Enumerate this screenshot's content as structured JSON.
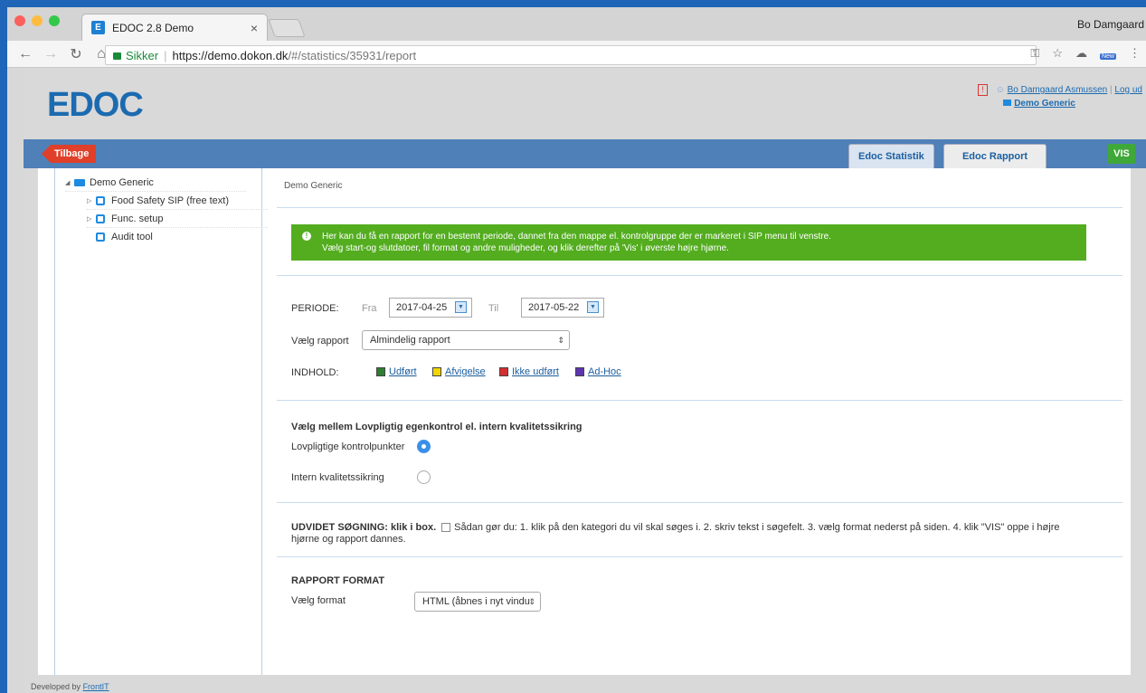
{
  "browser": {
    "tab_title": "EDOC 2.8 Demo",
    "tab_favicon": "E",
    "tab_close": "×",
    "user": "Bo Damgaard",
    "secure_label": "Sikker",
    "url_host": "https://demo.dokon.dk",
    "url_path": "/#/statistics/35931/report",
    "new_badge": "New",
    "colors": {
      "close": "#fc605c",
      "minimize": "#fdbc40",
      "maximize": "#34c84a"
    }
  },
  "header": {
    "logo": "EDOC",
    "alert": "!",
    "user_link": "Bo Damgaard Asmussen",
    "logout": "Log ud",
    "org": "Demo Generic"
  },
  "nav": {
    "back": "Tilbage",
    "tab_statistik": "Edoc Statistik",
    "tab_rapport": "Edoc Rapport",
    "vis": "VIS"
  },
  "sidebar": {
    "root": "Demo Generic",
    "items": [
      {
        "label": "Food Safety SIP (free text)"
      },
      {
        "label": "Func. setup"
      },
      {
        "label": "Audit tool"
      }
    ]
  },
  "main": {
    "breadcrumb": "Demo Generic",
    "info_line1": "Her kan du få en rapport for en bestemt periode, dannet fra den mappe el. kontrolgruppe der er markeret i SIP menu til venstre.",
    "info_line2": "Vælg start-og slutdatoer, fil format og andre muligheder, og klik derefter på 'Vis' i øverste højre hjørne.",
    "periode_label": "PERIODE:",
    "fra_label": "Fra",
    "fra_value": "2017-04-25",
    "til_label": "Til",
    "til_value": "2017-05-22",
    "rapport_label": "Vælg rapport",
    "rapport_value": "Almindelig rapport",
    "indhold_label": "INDHOLD:",
    "legend": [
      {
        "label": "Udført",
        "color": "#2e7d32"
      },
      {
        "label": "Afvigelse",
        "color": "#f2d600"
      },
      {
        "label": "Ikke udført",
        "color": "#d32f2f"
      },
      {
        "label": "Ad-Hoc",
        "color": "#5e35b1"
      }
    ],
    "choice_heading": "Vælg mellem Lovpligtig egenkontrol el. intern kvalitetssikring",
    "radio1": "Lovpligtige kontrolpunkter",
    "radio2": "Intern kvalitetssikring",
    "udvidet_heading": "UDVIDET SØGNING: klik i box.",
    "udvidet_text1": "Sådan gør du: 1. klik på den kategori du vil skal søges i. 2. skriv tekst i søgefelt. 3. vælg format nederst på siden. 4. klik \"VIS\" oppe i højre",
    "udvidet_text2": "hjørne og rapport dannes.",
    "format_heading": "RAPPORT FORMAT",
    "format_label": "Vælg format",
    "format_value": "HTML (åbnes i nyt vindu"
  },
  "footer": {
    "prefix": "Developed by",
    "link": "FrontIT"
  }
}
